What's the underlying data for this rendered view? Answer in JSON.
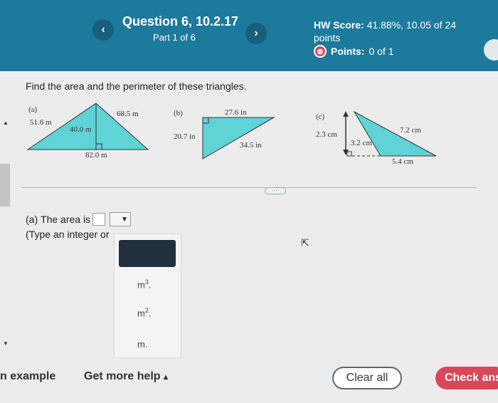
{
  "header": {
    "prev_icon": "‹",
    "next_icon": "›",
    "question_title": "Question 6, 10.2.17",
    "part_label": "Part 1 of 6",
    "hw_score_label": "HW Score:",
    "hw_score_value": "41.88%, 10.05 of 24 points",
    "points_icon": "⊗",
    "points_label": "Points:",
    "points_value": "0 of 1"
  },
  "prompt": "Find the area and the perimeter of these triangles.",
  "triangles": {
    "a": {
      "tag": "(a)",
      "side_left": "51.6 m",
      "height": "40.0 m",
      "side_right": "68.5 m",
      "base": "82.0 m"
    },
    "b": {
      "tag": "(b)",
      "top": "27.6 in",
      "left": "20.7 in",
      "hyp": "34.5 in"
    },
    "c": {
      "tag": "(c)",
      "height": "2.3 cm",
      "short": "3.2 cm",
      "long": "7.2 cm",
      "base": "5.4 cm"
    }
  },
  "more_label": "····",
  "part_a": {
    "label": "(a)",
    "text": "The area is",
    "hint": "(Type an integer or",
    "select_arrow": "▼"
  },
  "dropdown_options": [
    {
      "base": "m",
      "exp": "3",
      "suffix": "."
    },
    {
      "base": "m",
      "exp": "2",
      "suffix": "."
    },
    {
      "base": "m.",
      "exp": "",
      "suffix": ""
    }
  ],
  "footer": {
    "example_label": "n example",
    "help_label": "Get more help",
    "help_arrow": "▴",
    "clear_label": "Clear all",
    "check_label": "Check ans"
  },
  "colors": {
    "header_bg": "#1c7a9c",
    "triangle_fill": "#5fd3d6",
    "check_button": "#d8475a"
  }
}
